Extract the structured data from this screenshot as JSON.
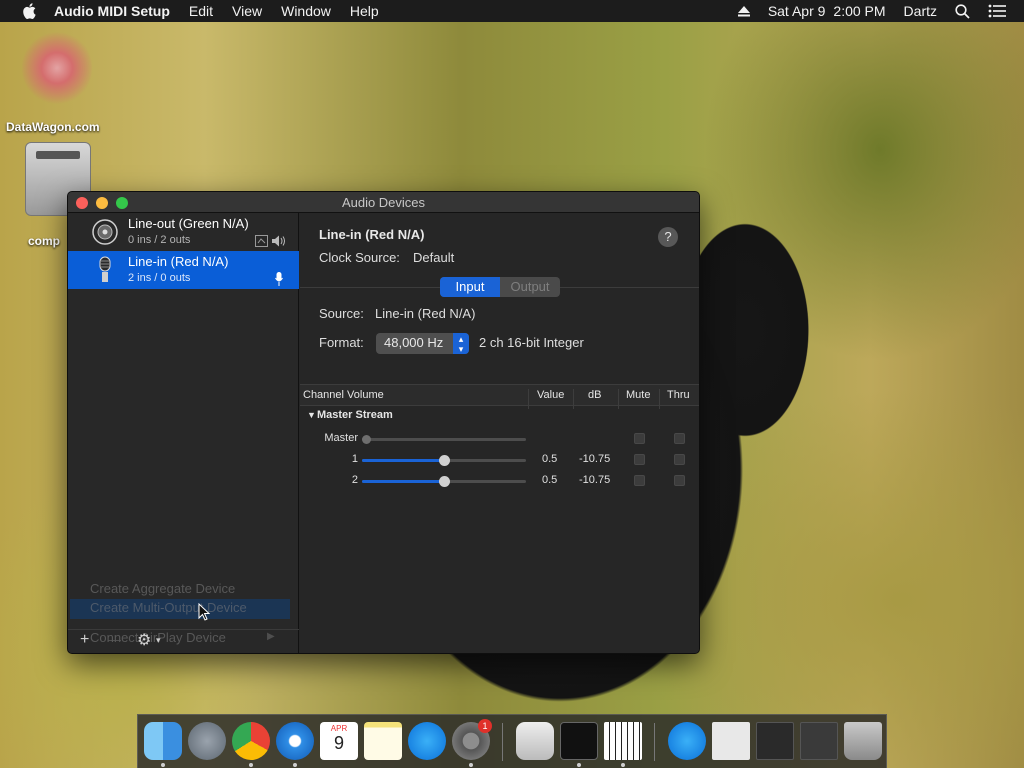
{
  "menubar": {
    "app_name": "Audio MIDI Setup",
    "menus": [
      "Edit",
      "View",
      "Window",
      "Help"
    ],
    "date": "Sat Apr 9",
    "time": "2:00 PM",
    "user": "Dartz"
  },
  "desktop": {
    "icon1_label": "DataWagon.com",
    "icon2_label": "comp"
  },
  "window": {
    "title": "Audio Devices"
  },
  "devices": [
    {
      "name": "Line-out (Green N/A)",
      "io": "0 ins / 2 outs",
      "icon": "speaker-icon",
      "selected": false
    },
    {
      "name": "Line-in (Red N/A)",
      "io": "2 ins / 0 outs",
      "icon": "microphone-icon",
      "selected": true
    }
  ],
  "popup_menu": {
    "items": [
      "Create Aggregate Device",
      "Create Multi-Output Device",
      "Connect AirPlay Device"
    ]
  },
  "sidebar_footer": {
    "add": "+",
    "remove": "—",
    "gear": "⚙"
  },
  "detail": {
    "device_title": "Line-in (Red N/A)",
    "clock_source_label": "Clock Source:",
    "clock_source_value": "Default",
    "help": "?",
    "tabs": [
      "Input",
      "Output"
    ],
    "active_tab": "Input",
    "source_label": "Source:",
    "source_value": "Line-in (Red N/A)",
    "format_label": "Format:",
    "format_rate": "48,000 Hz",
    "format_desc": "2 ch 16-bit Integer"
  },
  "table": {
    "headers": [
      "Channel Volume",
      "Value",
      "dB",
      "Mute",
      "Thru"
    ],
    "group": "Master Stream",
    "rows": [
      {
        "name": "Master",
        "level": 0.0,
        "value": "",
        "db": ""
      },
      {
        "name": "1",
        "level": 0.5,
        "value": "0.5",
        "db": "-10.75"
      },
      {
        "name": "2",
        "level": 0.5,
        "value": "0.5",
        "db": "-10.75"
      }
    ]
  },
  "colors": {
    "accent": "#0a5ed7",
    "window_bg": "#262626",
    "menubar_bg": "#1c1c1c"
  },
  "dock": {
    "items": [
      "finder",
      "launchpad",
      "chrome",
      "safari",
      "calendar",
      "notes",
      "app-store",
      "system-preferences",
      "script-editor",
      "terminal",
      "audio-midi-setup",
      "app-store-downloads",
      "file",
      "screenshot",
      "screenshot2",
      "trash"
    ],
    "calendar_month": "APR",
    "calendar_day": "9",
    "system_preferences_badge": "1"
  }
}
